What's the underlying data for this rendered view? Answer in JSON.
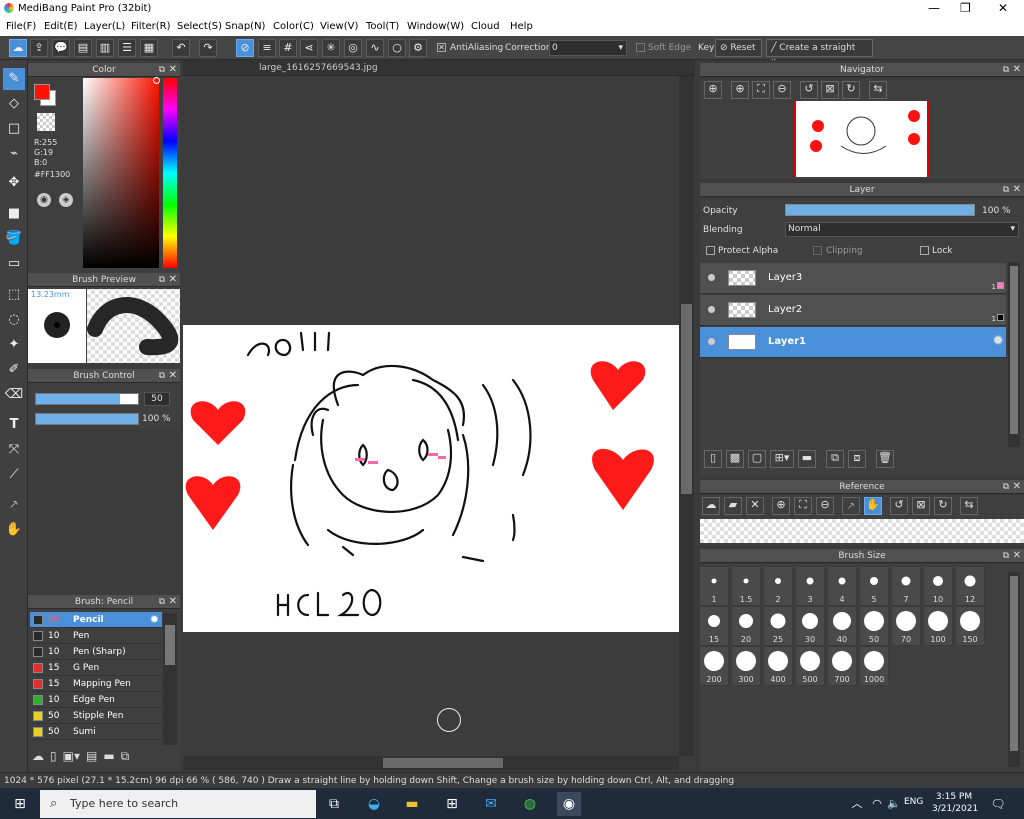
{
  "window": {
    "title": "MediBang Paint Pro (32bit)",
    "minimize": "—",
    "maximize": "❐",
    "close": "✕"
  },
  "menu": [
    "File(F)",
    "Edit(E)",
    "Layer(L)",
    "Filter(R)",
    "Select(S)",
    "Snap(N)",
    "Color(C)",
    "View(V)",
    "Tool(T)",
    "Window(W)",
    "Cloud",
    "Help"
  ],
  "toolbar": {
    "antialiasing": "AntiAliasing",
    "correction_label": "Correction",
    "correction_value": "0",
    "soft_edge": "Soft Edge",
    "key": "Key",
    "reset": "Reset",
    "straight_line": "Create a straight line"
  },
  "color_panel": {
    "title": "Color",
    "r": "R:255",
    "g": "G:19",
    "b": "B:0",
    "hex": "#FF1300",
    "fg": "#ff1300",
    "bg": "#ffffff"
  },
  "brush_preview": {
    "title": "Brush Preview",
    "size": "13.23mm"
  },
  "brush_control": {
    "title": "Brush Control",
    "size_value": "50",
    "opacity_value": "100 %",
    "size_level": 0.82,
    "opacity_level": 1.0
  },
  "document": {
    "tab": "large_1616257669543.jpg",
    "sketch_text": "ℷ𝗈!!!",
    "sketch_caption": "HCL 20"
  },
  "brush_list": {
    "title": "Brush: Pencil",
    "items": [
      {
        "size": "50",
        "name": "Pencil",
        "color": "#2a2a2a"
      },
      {
        "size": "10",
        "name": "Pen",
        "color": "#2a2a2a"
      },
      {
        "size": "10",
        "name": "Pen (Sharp)",
        "color": "#2a2a2a"
      },
      {
        "size": "15",
        "name": "G Pen",
        "color": "#e03030"
      },
      {
        "size": "15",
        "name": "Mapping Pen",
        "color": "#e03030"
      },
      {
        "size": "10",
        "name": "Edge Pen",
        "color": "#30b030"
      },
      {
        "size": "50",
        "name": "Stipple Pen",
        "color": "#e8d020"
      },
      {
        "size": "50",
        "name": "Sumi",
        "color": "#e8d020"
      }
    ]
  },
  "navigator": {
    "title": "Navigator"
  },
  "layer_panel": {
    "title": "Layer",
    "opacity_label": "Opacity",
    "opacity_value": "100 %",
    "blending_label": "Blending",
    "blending_value": "Normal",
    "protect_alpha": "Protect Alpha",
    "clipping": "Clipping",
    "lock": "Lock",
    "layers": [
      {
        "name": "Layer3",
        "count": "1",
        "swatch": "#ff80c0"
      },
      {
        "name": "Layer2",
        "count": "1",
        "swatch": "#000000"
      },
      {
        "name": "Layer1"
      }
    ]
  },
  "reference": {
    "title": "Reference"
  },
  "brush_size": {
    "title": "Brush Size",
    "sizes": [
      "1",
      "1.5",
      "2",
      "3",
      "4",
      "5",
      "7",
      "10",
      "12",
      "15",
      "20",
      "25",
      "30",
      "40",
      "50",
      "70",
      "100",
      "150",
      "200",
      "300",
      "400",
      "500",
      "700",
      "1000"
    ]
  },
  "status": {
    "text": "1024 * 576 pixel   (27.1 * 15.2cm)   96 dpi   66 %   ( 586, 740 )   Draw a straight line by holding down Shift, Change a brush size by holding down Ctrl, Alt, and dragging"
  },
  "taskbar": {
    "search_placeholder": "Type here to search",
    "lang": "ENG",
    "time": "3:15 PM",
    "date": "3/21/2021"
  }
}
